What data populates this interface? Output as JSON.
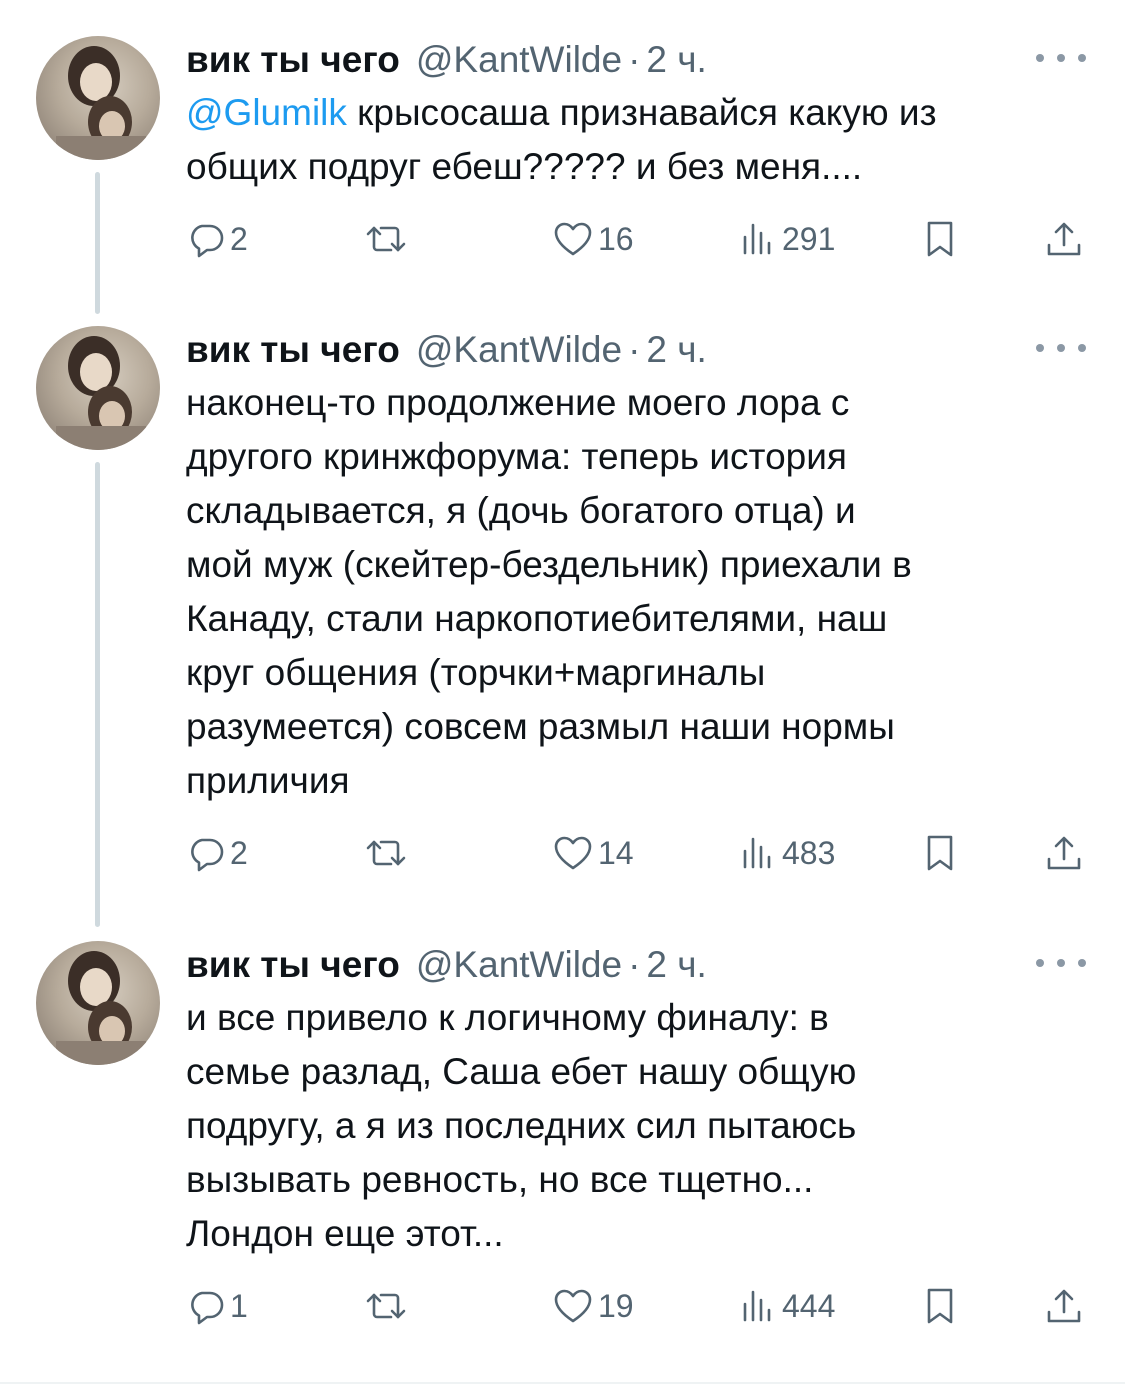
{
  "tweets": [
    {
      "display_name": "вик ты чего",
      "handle": "@KantWilde",
      "separator": "·",
      "time": "2 ч.",
      "mention": "@Glumilk",
      "text": " крысосаша признавайся какую из\nобщих подруг ебеш????? и без меня....",
      "replies": "2",
      "reposts": "",
      "likes": "16",
      "views": "291"
    },
    {
      "display_name": "вик ты чего",
      "handle": "@KantWilde",
      "separator": "·",
      "time": "2 ч.",
      "mention": "",
      "text": "наконец-то продолжение моего лора с\nдругого кринжфорума: теперь история\nскладывается, я (дочь богатого отца) и\nмой муж (скейтер-бездельник) приехали в\nКанаду, стали наркопотиебителями, наш\nкруг общения (торчки+маргиналы\nразумеется) совсем размыл наши нормы\nприличия",
      "replies": "2",
      "reposts": "",
      "likes": "14",
      "views": "483"
    },
    {
      "display_name": "вик ты чего",
      "handle": "@KantWilde",
      "separator": "·",
      "time": "2 ч.",
      "mention": "",
      "text": "и все привело к логичному финалу: в\nсемье разлад, Саша ебет нашу общую\nподругу, а я из последних сил пытаюсь\nвызывать ревность, но все тщетно...\nЛондон еще этот...",
      "replies": "1",
      "reposts": "",
      "likes": "19",
      "views": "444"
    }
  ],
  "icons": {
    "reply": "reply-bubble-icon",
    "repost": "repost-arrows-icon",
    "like": "heart-icon",
    "views": "views-bar-chart-icon",
    "bookmark": "bookmark-icon",
    "share": "share-upload-icon",
    "more": "more-dots-icon"
  },
  "colors": {
    "text": "#0f1419",
    "secondary": "#536471",
    "mention": "#1d9bf0",
    "thread_line": "#cfd9de"
  }
}
